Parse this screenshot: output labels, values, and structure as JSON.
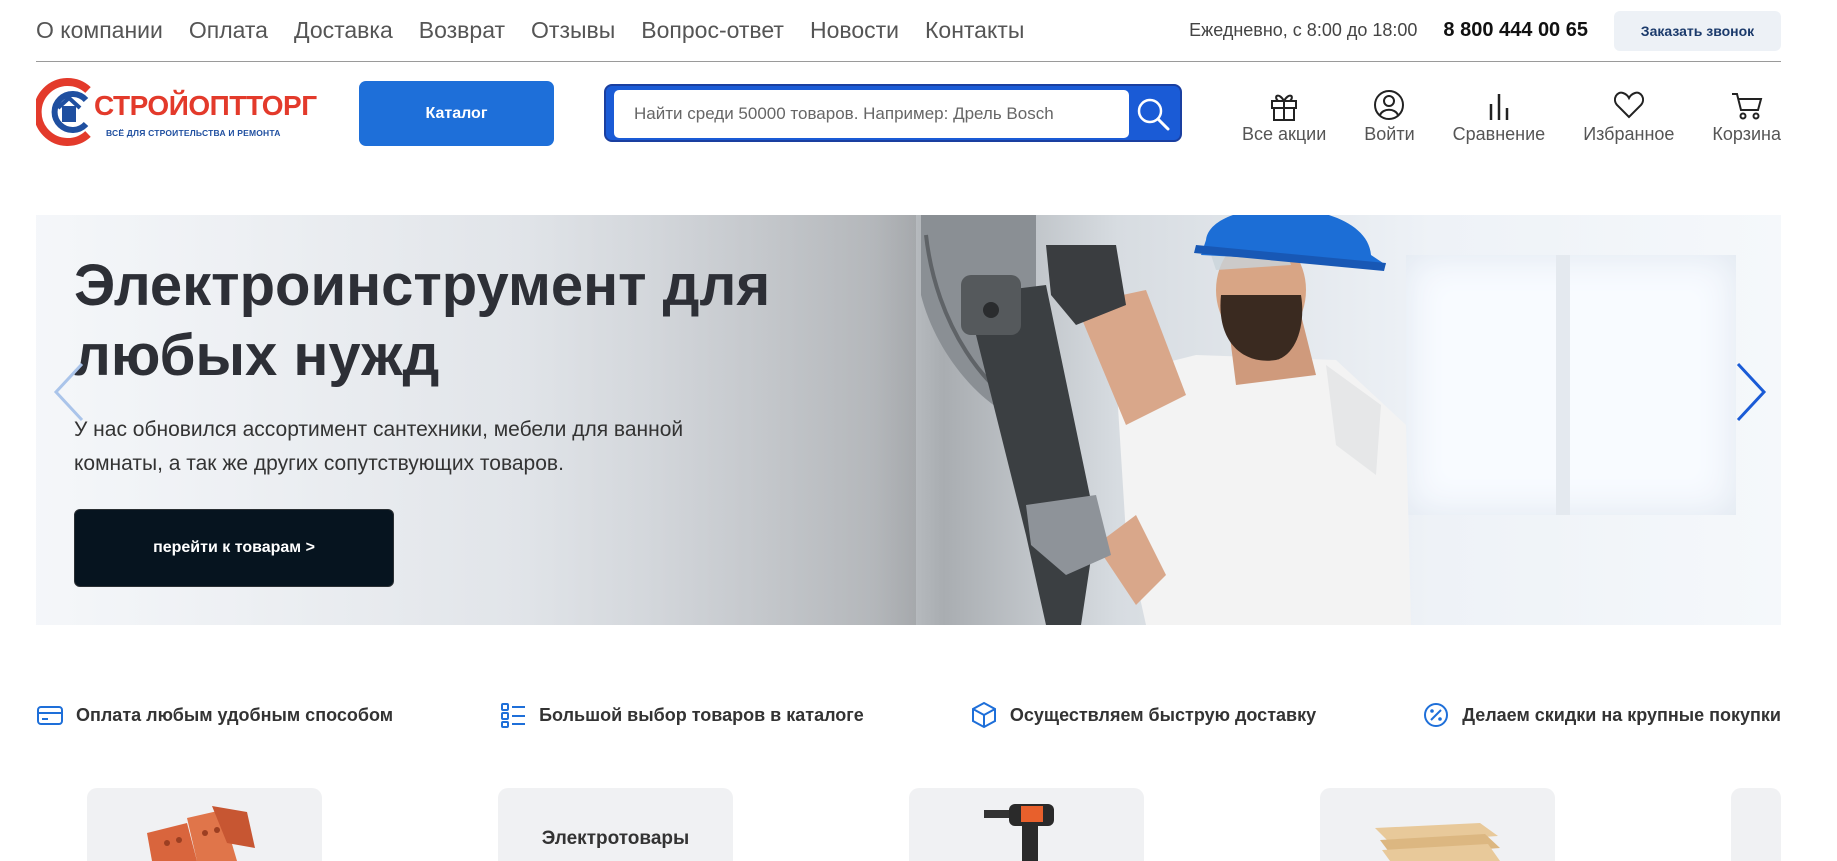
{
  "topnav": {
    "items": [
      "О компании",
      "Оплата",
      "Доставка",
      "Возврат",
      "Отзывы",
      "Вопрос-ответ",
      "Новости",
      "Контакты"
    ]
  },
  "contacts": {
    "hours": "Ежедневно, с 8:00 до 18:00",
    "phone": "8 800 444 00 65",
    "callback_label": "Заказать звонок"
  },
  "logo": {
    "name": "СТРОЙОПТТОРГ",
    "tagline": "ВСЁ ДЛЯ СТРОИТЕЛЬСТВА И РЕМОНТА"
  },
  "header": {
    "catalog_label": "Каталог",
    "search_placeholder": "Найти среди 50000 товаров. Например: Дрель Bosch",
    "icons": [
      {
        "label": "Все акции",
        "icon": "gift-icon"
      },
      {
        "label": "Войти",
        "icon": "user-icon"
      },
      {
        "label": "Сравнение",
        "icon": "compare-icon"
      },
      {
        "label": "Избранное",
        "icon": "heart-icon"
      },
      {
        "label": "Корзина",
        "icon": "cart-icon"
      }
    ]
  },
  "banner": {
    "title": "Электроинструмент для любых нужд",
    "text": "У нас обновился ассортимент сантехники, мебели для ванной комнаты, а так же других сопутствующих товаров.",
    "button_label": "перейти к товарам >"
  },
  "features": [
    {
      "label": "Оплата любым удобным способом",
      "icon": "card-icon"
    },
    {
      "label": "Большой выбор товаров в каталоге",
      "icon": "list-icon"
    },
    {
      "label": "Осуществляем быструю доставку",
      "icon": "box-icon"
    },
    {
      "label": "Делаем скидки на крупные покупки",
      "icon": "percent-icon"
    }
  ],
  "categories": [
    {
      "label": "",
      "icon": "brick-icon"
    },
    {
      "label": "Электротовары",
      "icon": ""
    },
    {
      "label": "",
      "icon": "drill-icon"
    },
    {
      "label": "",
      "icon": "lumber-icon"
    },
    {
      "label": "",
      "icon": ""
    }
  ],
  "colors": {
    "accent": "#1e6fd9",
    "logo_red": "#e33a2b",
    "logo_blue": "#1f4fa0",
    "button_dark": "#06141f"
  }
}
